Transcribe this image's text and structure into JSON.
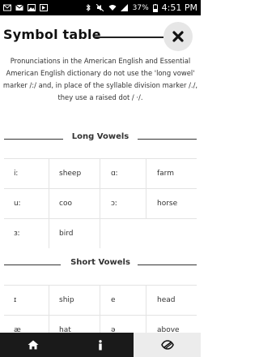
{
  "status_bar": {
    "time": "4:51 PM",
    "battery": "37%",
    "icons": [
      "mail-icon",
      "gmail-icon",
      "image-icon",
      "notification-icon",
      "bluetooth-icon",
      "mute-icon",
      "wifi-icon",
      "signal-icon",
      "battery-icon"
    ]
  },
  "header": {
    "title": "Symbol table",
    "close_icon": "close-icon"
  },
  "intro": {
    "text": "Pronunciations in the American English and Essential American English dictionary do not use the 'long vowel' marker /:/ and, in place of the syllable division marker /./, they use a raised dot / ·/."
  },
  "sections": [
    {
      "title": "Long Vowels",
      "rows": [
        [
          {
            "symbol": "iː",
            "word": "sheep"
          },
          {
            "symbol": "ɑː",
            "word": "farm"
          }
        ],
        [
          {
            "symbol": "uː",
            "word": "coo"
          },
          {
            "symbol": "ɔː",
            "word": "horse"
          }
        ],
        [
          {
            "symbol": "ɜː",
            "word": "bird"
          }
        ]
      ]
    },
    {
      "title": "Short Vowels",
      "rows": [
        [
          {
            "symbol": "ɪ",
            "word": "ship"
          },
          {
            "symbol": "e",
            "word": "head"
          }
        ],
        [
          {
            "symbol": "æ",
            "word": "hat"
          },
          {
            "symbol": "ə",
            "word": "above"
          }
        ]
      ]
    }
  ],
  "bottom_nav": [
    {
      "name": "home",
      "icon": "home-icon",
      "active": false
    },
    {
      "name": "info",
      "icon": "info-icon",
      "active": false
    },
    {
      "name": "symbols",
      "icon": "phonetic-symbol-icon",
      "active": true
    }
  ]
}
